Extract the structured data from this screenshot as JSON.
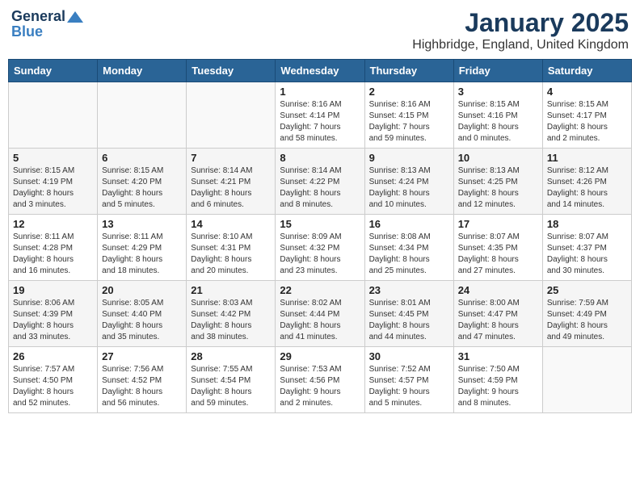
{
  "header": {
    "logo_general": "General",
    "logo_blue": "Blue",
    "month_title": "January 2025",
    "location": "Highbridge, England, United Kingdom"
  },
  "weekdays": [
    "Sunday",
    "Monday",
    "Tuesday",
    "Wednesday",
    "Thursday",
    "Friday",
    "Saturday"
  ],
  "weeks": [
    [
      {
        "day": "",
        "info": ""
      },
      {
        "day": "",
        "info": ""
      },
      {
        "day": "",
        "info": ""
      },
      {
        "day": "1",
        "info": "Sunrise: 8:16 AM\nSunset: 4:14 PM\nDaylight: 7 hours\nand 58 minutes."
      },
      {
        "day": "2",
        "info": "Sunrise: 8:16 AM\nSunset: 4:15 PM\nDaylight: 7 hours\nand 59 minutes."
      },
      {
        "day": "3",
        "info": "Sunrise: 8:15 AM\nSunset: 4:16 PM\nDaylight: 8 hours\nand 0 minutes."
      },
      {
        "day": "4",
        "info": "Sunrise: 8:15 AM\nSunset: 4:17 PM\nDaylight: 8 hours\nand 2 minutes."
      }
    ],
    [
      {
        "day": "5",
        "info": "Sunrise: 8:15 AM\nSunset: 4:19 PM\nDaylight: 8 hours\nand 3 minutes."
      },
      {
        "day": "6",
        "info": "Sunrise: 8:15 AM\nSunset: 4:20 PM\nDaylight: 8 hours\nand 5 minutes."
      },
      {
        "day": "7",
        "info": "Sunrise: 8:14 AM\nSunset: 4:21 PM\nDaylight: 8 hours\nand 6 minutes."
      },
      {
        "day": "8",
        "info": "Sunrise: 8:14 AM\nSunset: 4:22 PM\nDaylight: 8 hours\nand 8 minutes."
      },
      {
        "day": "9",
        "info": "Sunrise: 8:13 AM\nSunset: 4:24 PM\nDaylight: 8 hours\nand 10 minutes."
      },
      {
        "day": "10",
        "info": "Sunrise: 8:13 AM\nSunset: 4:25 PM\nDaylight: 8 hours\nand 12 minutes."
      },
      {
        "day": "11",
        "info": "Sunrise: 8:12 AM\nSunset: 4:26 PM\nDaylight: 8 hours\nand 14 minutes."
      }
    ],
    [
      {
        "day": "12",
        "info": "Sunrise: 8:11 AM\nSunset: 4:28 PM\nDaylight: 8 hours\nand 16 minutes."
      },
      {
        "day": "13",
        "info": "Sunrise: 8:11 AM\nSunset: 4:29 PM\nDaylight: 8 hours\nand 18 minutes."
      },
      {
        "day": "14",
        "info": "Sunrise: 8:10 AM\nSunset: 4:31 PM\nDaylight: 8 hours\nand 20 minutes."
      },
      {
        "day": "15",
        "info": "Sunrise: 8:09 AM\nSunset: 4:32 PM\nDaylight: 8 hours\nand 23 minutes."
      },
      {
        "day": "16",
        "info": "Sunrise: 8:08 AM\nSunset: 4:34 PM\nDaylight: 8 hours\nand 25 minutes."
      },
      {
        "day": "17",
        "info": "Sunrise: 8:07 AM\nSunset: 4:35 PM\nDaylight: 8 hours\nand 27 minutes."
      },
      {
        "day": "18",
        "info": "Sunrise: 8:07 AM\nSunset: 4:37 PM\nDaylight: 8 hours\nand 30 minutes."
      }
    ],
    [
      {
        "day": "19",
        "info": "Sunrise: 8:06 AM\nSunset: 4:39 PM\nDaylight: 8 hours\nand 33 minutes."
      },
      {
        "day": "20",
        "info": "Sunrise: 8:05 AM\nSunset: 4:40 PM\nDaylight: 8 hours\nand 35 minutes."
      },
      {
        "day": "21",
        "info": "Sunrise: 8:03 AM\nSunset: 4:42 PM\nDaylight: 8 hours\nand 38 minutes."
      },
      {
        "day": "22",
        "info": "Sunrise: 8:02 AM\nSunset: 4:44 PM\nDaylight: 8 hours\nand 41 minutes."
      },
      {
        "day": "23",
        "info": "Sunrise: 8:01 AM\nSunset: 4:45 PM\nDaylight: 8 hours\nand 44 minutes."
      },
      {
        "day": "24",
        "info": "Sunrise: 8:00 AM\nSunset: 4:47 PM\nDaylight: 8 hours\nand 47 minutes."
      },
      {
        "day": "25",
        "info": "Sunrise: 7:59 AM\nSunset: 4:49 PM\nDaylight: 8 hours\nand 49 minutes."
      }
    ],
    [
      {
        "day": "26",
        "info": "Sunrise: 7:57 AM\nSunset: 4:50 PM\nDaylight: 8 hours\nand 52 minutes."
      },
      {
        "day": "27",
        "info": "Sunrise: 7:56 AM\nSunset: 4:52 PM\nDaylight: 8 hours\nand 56 minutes."
      },
      {
        "day": "28",
        "info": "Sunrise: 7:55 AM\nSunset: 4:54 PM\nDaylight: 8 hours\nand 59 minutes."
      },
      {
        "day": "29",
        "info": "Sunrise: 7:53 AM\nSunset: 4:56 PM\nDaylight: 9 hours\nand 2 minutes."
      },
      {
        "day": "30",
        "info": "Sunrise: 7:52 AM\nSunset: 4:57 PM\nDaylight: 9 hours\nand 5 minutes."
      },
      {
        "day": "31",
        "info": "Sunrise: 7:50 AM\nSunset: 4:59 PM\nDaylight: 9 hours\nand 8 minutes."
      },
      {
        "day": "",
        "info": ""
      }
    ]
  ]
}
